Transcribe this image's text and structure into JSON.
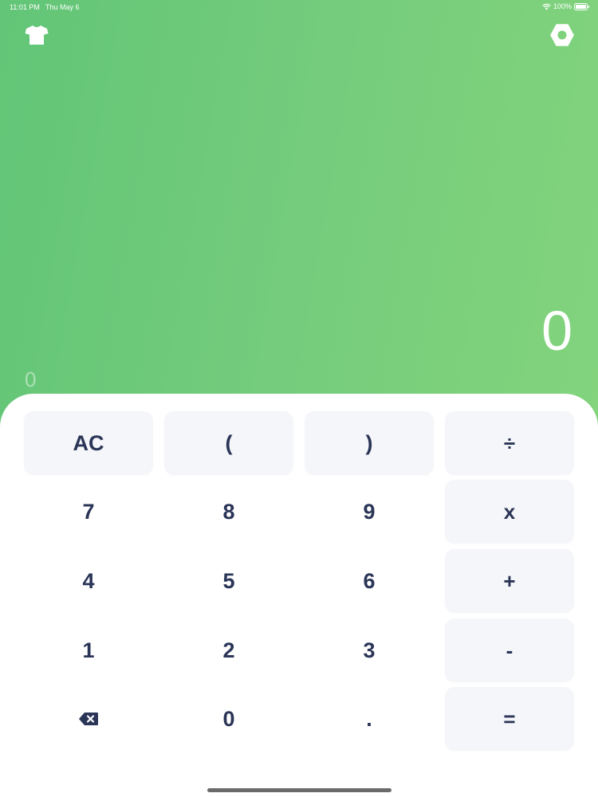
{
  "status_bar": {
    "time": "11:01 PM",
    "date": "Thu May 6",
    "battery_text": "100%"
  },
  "icons": {
    "theme": "shirt-icon",
    "settings": "gear-icon",
    "wifi": "wifi-icon",
    "battery": "battery-icon",
    "backspace": "backspace-icon"
  },
  "display": {
    "result": "0",
    "expression": "0"
  },
  "keys": {
    "ac": "AC",
    "open_paren": "(",
    "close_paren": ")",
    "divide": "÷",
    "seven": "7",
    "eight": "8",
    "nine": "9",
    "multiply": "x",
    "four": "4",
    "five": "5",
    "six": "6",
    "plus": "+",
    "one": "1",
    "two": "2",
    "three": "3",
    "minus": "-",
    "zero": "0",
    "decimal": ".",
    "equals": "="
  },
  "colors": {
    "gradient_start": "#62c577",
    "gradient_end": "#86d57d",
    "key_text": "#2a3557",
    "key_bg": "#f5f6f9"
  }
}
